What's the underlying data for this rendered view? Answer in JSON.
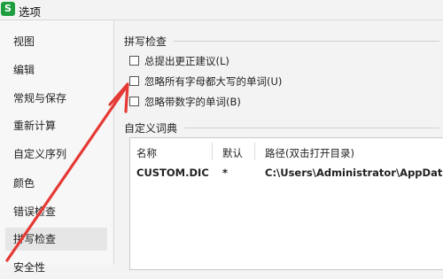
{
  "window": {
    "title": "选项",
    "logo_letter": "S"
  },
  "sidebar": {
    "items": [
      {
        "label": "视图"
      },
      {
        "label": "编辑"
      },
      {
        "label": "常规与保存"
      },
      {
        "label": "重新计算"
      },
      {
        "label": "自定义序列"
      },
      {
        "label": "颜色"
      },
      {
        "label": "错误检查"
      },
      {
        "label": "拼写检查",
        "selected": true
      },
      {
        "label": "安全性"
      }
    ]
  },
  "spelling": {
    "group_title": "拼写检查",
    "options": [
      {
        "label": "总提出更正建议(L)",
        "checked": false
      },
      {
        "label": "忽略所有字母都大写的单词(U)",
        "checked": false
      },
      {
        "label": "忽略带数字的单词(B)",
        "checked": false
      }
    ]
  },
  "dictionary": {
    "group_title": "自定义词典",
    "columns": {
      "name": "名称",
      "default": "默认",
      "path": "路径(双击打开目录)"
    },
    "rows": [
      {
        "name": "CUSTOM.DIC",
        "default": "*",
        "path": "C:\\Users\\Administrator\\AppData\\"
      }
    ]
  },
  "colors": {
    "logo": "#1f9e3f",
    "annotation_arrow": "#e53935",
    "selected_item_bg": "#e6e6e6"
  }
}
